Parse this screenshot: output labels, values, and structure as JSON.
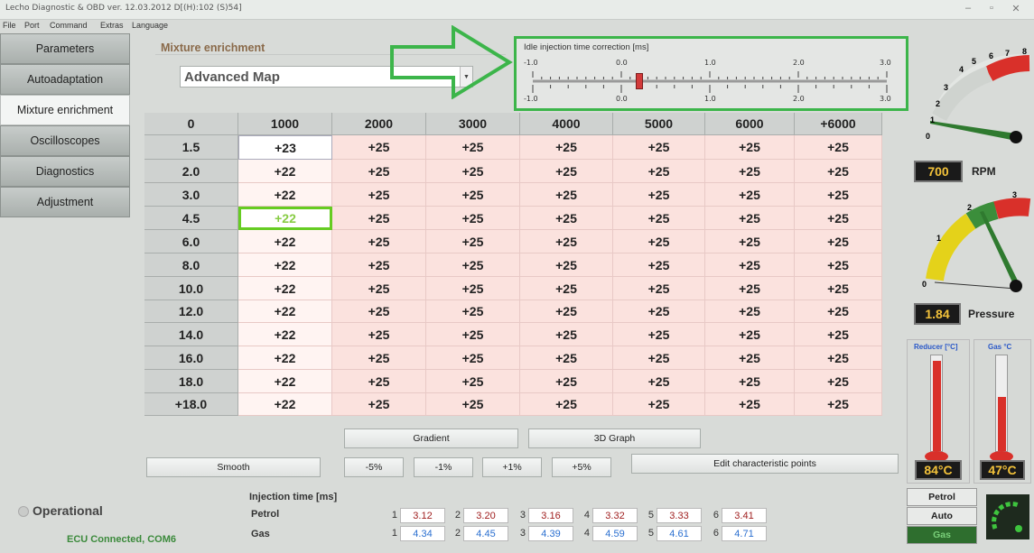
{
  "window": {
    "title": "Lecho Diagnostic & OBD ver. 12.03.2012 D[(H):102 (S)54]"
  },
  "menu": [
    "File",
    "Port",
    "Command",
    "Extras",
    "Language"
  ],
  "sidebar": {
    "items": [
      {
        "label": "Parameters"
      },
      {
        "label": "Autoadaptation"
      },
      {
        "label": "Mixture enrichment"
      },
      {
        "label": "Oscilloscopes"
      },
      {
        "label": "Diagnostics"
      },
      {
        "label": "Adjustment"
      }
    ]
  },
  "mixture": {
    "title": "Mixture enrichment",
    "map_selected": "Advanced Map"
  },
  "idle": {
    "title": "Idle injection time correction [ms]",
    "ticks_top": [
      "-1.0",
      "0.0",
      "1.0",
      "2.0",
      "3.0"
    ],
    "ticks_bottom": [
      "-1.0",
      "0.0",
      "1.0",
      "2.0",
      "3.0"
    ],
    "value": 0.2,
    "min": -1.0,
    "max": 3.0
  },
  "table": {
    "corner": "0",
    "columns": [
      "1000",
      "2000",
      "3000",
      "4000",
      "5000",
      "6000",
      "+6000"
    ],
    "rows": [
      {
        "label": "1.5",
        "values": [
          "+23",
          "+25",
          "+25",
          "+25",
          "+25",
          "+25",
          "+25"
        ]
      },
      {
        "label": "2.0",
        "values": [
          "+22",
          "+25",
          "+25",
          "+25",
          "+25",
          "+25",
          "+25"
        ]
      },
      {
        "label": "3.0",
        "values": [
          "+22",
          "+25",
          "+25",
          "+25",
          "+25",
          "+25",
          "+25"
        ]
      },
      {
        "label": "4.5",
        "values": [
          "+22",
          "+25",
          "+25",
          "+25",
          "+25",
          "+25",
          "+25"
        ]
      },
      {
        "label": "6.0",
        "values": [
          "+22",
          "+25",
          "+25",
          "+25",
          "+25",
          "+25",
          "+25"
        ]
      },
      {
        "label": "8.0",
        "values": [
          "+22",
          "+25",
          "+25",
          "+25",
          "+25",
          "+25",
          "+25"
        ]
      },
      {
        "label": "10.0",
        "values": [
          "+22",
          "+25",
          "+25",
          "+25",
          "+25",
          "+25",
          "+25"
        ]
      },
      {
        "label": "12.0",
        "values": [
          "+22",
          "+25",
          "+25",
          "+25",
          "+25",
          "+25",
          "+25"
        ]
      },
      {
        "label": "14.0",
        "values": [
          "+22",
          "+25",
          "+25",
          "+25",
          "+25",
          "+25",
          "+25"
        ]
      },
      {
        "label": "16.0",
        "values": [
          "+22",
          "+25",
          "+25",
          "+25",
          "+25",
          "+25",
          "+25"
        ]
      },
      {
        "label": "18.0",
        "values": [
          "+22",
          "+25",
          "+25",
          "+25",
          "+25",
          "+25",
          "+25"
        ]
      },
      {
        "label": "+18.0",
        "values": [
          "+22",
          "+25",
          "+25",
          "+25",
          "+25",
          "+25",
          "+25"
        ]
      }
    ]
  },
  "buttons": {
    "gradient": "Gradient",
    "graph3d": "3D Graph",
    "smooth": "Smooth",
    "m5": "-5%",
    "m1": "-1%",
    "p1": "+1%",
    "p5": "+5%",
    "edit": "Edit characteristic points"
  },
  "injection": {
    "title": "Injection time [ms]",
    "petrol_label": "Petrol",
    "gas_label": "Gas",
    "numbers": [
      "1",
      "2",
      "3",
      "4",
      "5",
      "6"
    ],
    "petrol": [
      "3.12",
      "3.20",
      "3.16",
      "3.32",
      "3.33",
      "3.41"
    ],
    "gas": [
      "4.34",
      "4.45",
      "4.39",
      "4.59",
      "4.61",
      "4.71"
    ]
  },
  "status": {
    "state": "Operational",
    "connection": "ECU Connected, COM6"
  },
  "gauges": {
    "rpm": {
      "value": "700",
      "label": "RPM",
      "ticks": [
        "0",
        "1",
        "2",
        "3",
        "4",
        "5",
        "6",
        "7",
        "8"
      ]
    },
    "pressure": {
      "value": "1.84",
      "label": "Pressure",
      "ticks": [
        "0",
        "1",
        "2",
        "3"
      ]
    },
    "reducer": {
      "label": "Reducer [°C]",
      "value": "84°C"
    },
    "gas_temp": {
      "label": "Gas °C",
      "value": "47°C"
    }
  },
  "modes": [
    "Petrol",
    "Auto",
    "Gas"
  ],
  "colors": {
    "highlight": "#3cb54a",
    "table_bg": "#fbe2de",
    "lcd_text": "#f3c23a"
  }
}
